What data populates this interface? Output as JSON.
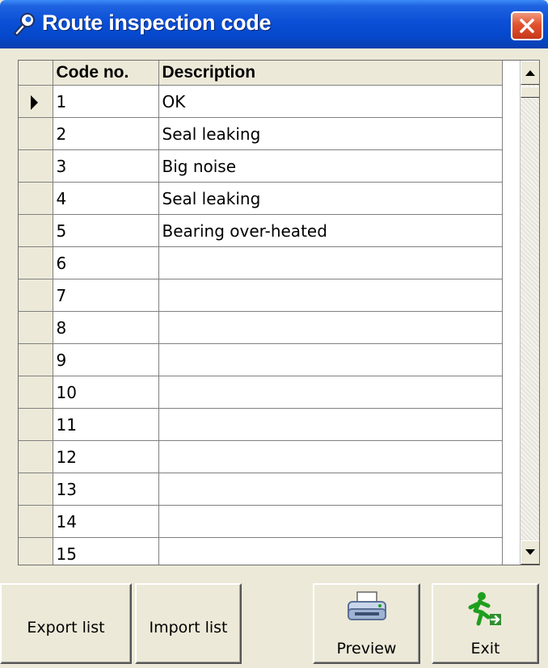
{
  "window": {
    "title": "Route inspection code"
  },
  "grid": {
    "columns": [
      "Code no.",
      "Description"
    ],
    "current_row": 0,
    "rows": [
      {
        "code": "1",
        "description": "OK"
      },
      {
        "code": "2",
        "description": "Seal leaking"
      },
      {
        "code": "3",
        "description": "Big noise"
      },
      {
        "code": "4",
        "description": "Seal leaking"
      },
      {
        "code": "5",
        "description": "Bearing over-heated"
      },
      {
        "code": "6",
        "description": ""
      },
      {
        "code": "7",
        "description": ""
      },
      {
        "code": "8",
        "description": ""
      },
      {
        "code": "9",
        "description": ""
      },
      {
        "code": "10",
        "description": ""
      },
      {
        "code": "11",
        "description": ""
      },
      {
        "code": "12",
        "description": ""
      },
      {
        "code": "13",
        "description": ""
      },
      {
        "code": "14",
        "description": ""
      },
      {
        "code": "15",
        "description": ""
      }
    ]
  },
  "buttons": {
    "export_label": "Export list",
    "import_label": "Import list",
    "preview_label": "Preview",
    "exit_label": "Exit"
  },
  "icons": {
    "title": "wrench-icon",
    "close": "close-icon",
    "preview": "printer-icon",
    "exit": "running-man-exit-icon"
  },
  "colors": {
    "titlebar": "#0a4fd6",
    "close": "#e2532e",
    "face": "#ece9d8"
  }
}
